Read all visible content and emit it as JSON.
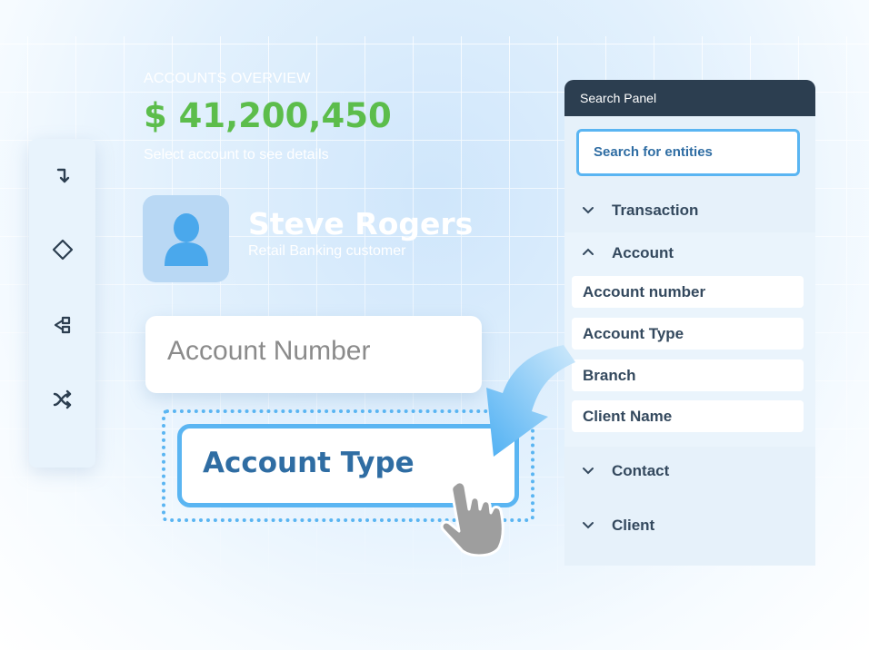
{
  "overview": {
    "label": "ACCOUNTS OVERVIEW",
    "total": "$ 41,200,450",
    "hint": "Select account to see details"
  },
  "customer": {
    "name": "Steve Rogers",
    "type": "Retail Banking customer"
  },
  "toolbar": {
    "tools": [
      "turn-down-arrow-icon",
      "diamond-icon",
      "split-branch-icon",
      "shuffle-icon"
    ]
  },
  "fields": {
    "account_number": "Account Number",
    "account_type": "Account Type"
  },
  "search_panel": {
    "title": "Search Panel",
    "search_placeholder": "Search for entities",
    "sections": {
      "transaction": "Transaction",
      "account": "Account",
      "contact": "Contact",
      "client": "Client"
    },
    "account_items": [
      "Account number",
      "Account Type",
      "Branch",
      "Client Name"
    ]
  },
  "colors": {
    "accent": "#5ab5f2",
    "total_green": "#5cbd4b",
    "panel_header": "#2c3e50",
    "text_dark": "#34495e",
    "text_blue": "#2f6da3"
  }
}
